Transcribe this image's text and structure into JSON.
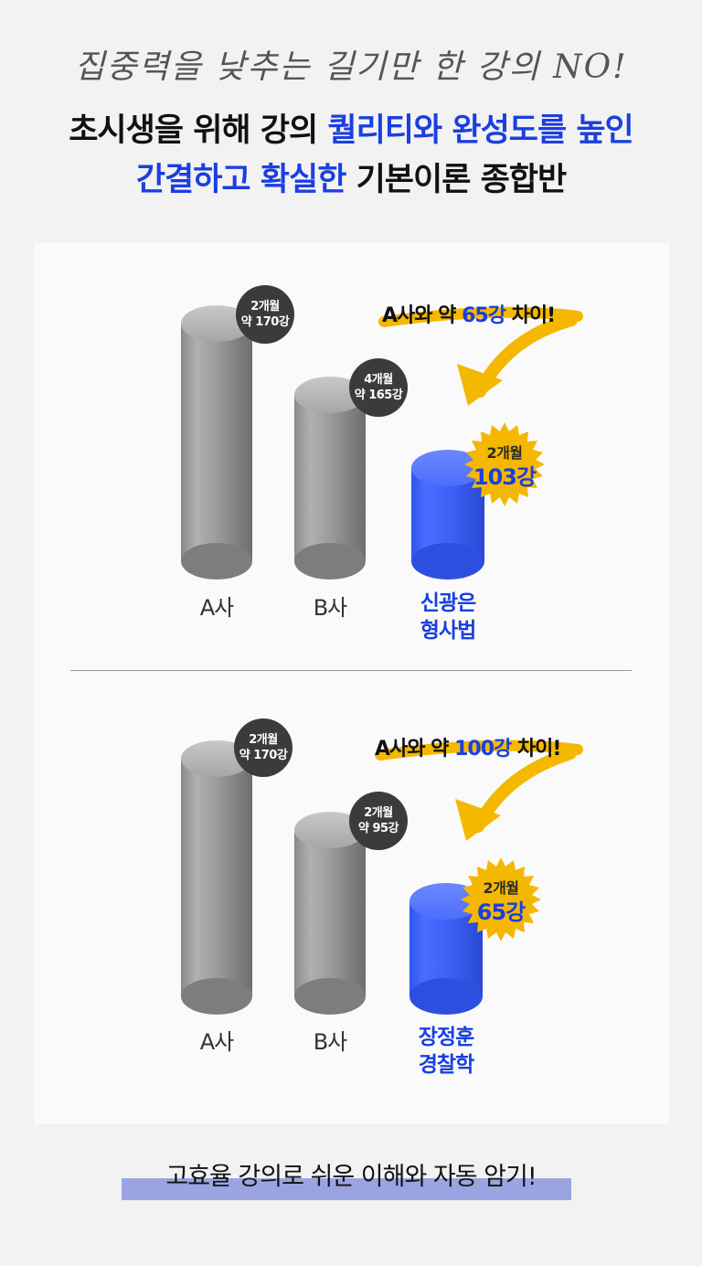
{
  "header": {
    "tagline": "집중력을 낮추는 길기만 한 강의 NO!",
    "line1_black": "초시생을 위해 강의 ",
    "line1_blue": "퀄리티와 완성도를 높인",
    "line2_blue": "간결하고 확실한",
    "line2_black": " 기본이론 종합반"
  },
  "comparisons": [
    {
      "diff_prefix": "A사와 약 ",
      "diff_value": "65강",
      "diff_suffix": " 차이!",
      "a": {
        "label": "A사",
        "badge_line1": "2개월",
        "badge_line2": "약 170강",
        "lectures": 170
      },
      "b": {
        "label": "B사",
        "badge_line1": "4개월",
        "badge_line2": "약 165강",
        "lectures": 165
      },
      "ours": {
        "label_line1": "신광은",
        "label_line2": "형사법",
        "badge_line1": "2개월",
        "badge_line2": "103강",
        "lectures": 103
      }
    },
    {
      "diff_prefix": "A사와 약 ",
      "diff_value": "100강",
      "diff_suffix": " 차이!",
      "a": {
        "label": "A사",
        "badge_line1": "2개월",
        "badge_line2": "약 170강",
        "lectures": 170
      },
      "b": {
        "label": "B사",
        "badge_line1": "2개월",
        "badge_line2": "약 95강",
        "lectures": 95
      },
      "ours": {
        "label_line1": "장정훈",
        "label_line2": "경찰학",
        "badge_line1": "2개월",
        "badge_line2": "65강",
        "lectures": 65
      }
    }
  ],
  "footer": {
    "text": "고효율 강의로 쉬운 이해와 자동 암기!"
  },
  "colors": {
    "accent_blue": "#1a3fe0",
    "arrow_yellow": "#f5b800",
    "highlight": "#9aa4e0"
  },
  "icons": [
    "curved-arrow-icon",
    "starburst-badge-icon"
  ]
}
